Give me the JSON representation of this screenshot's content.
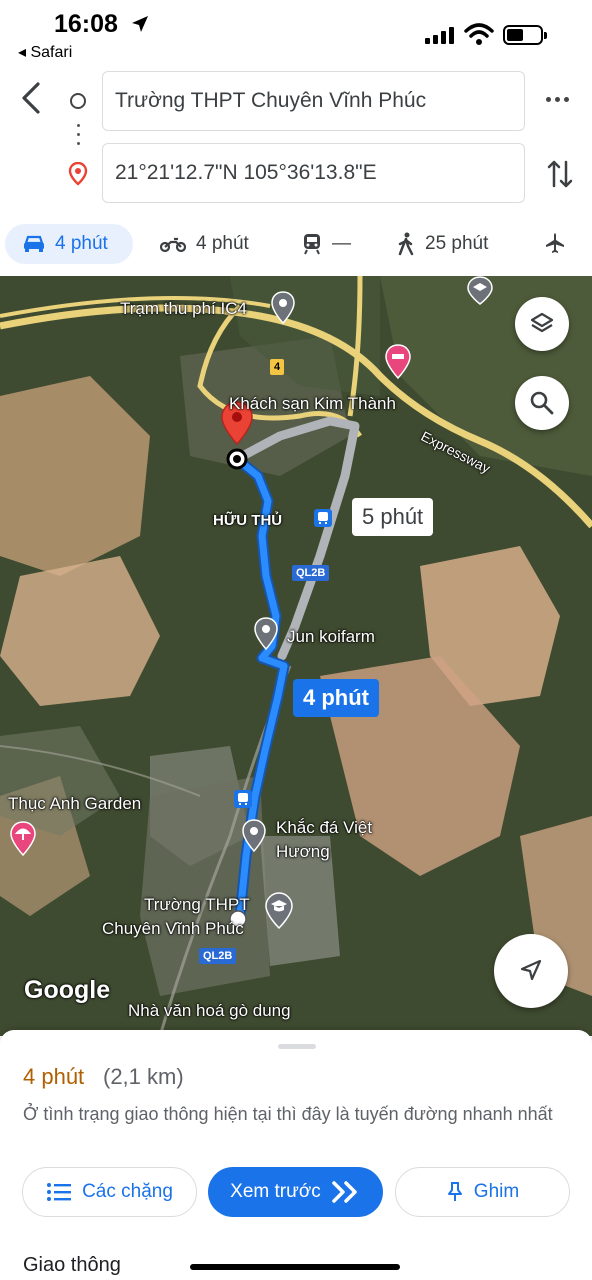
{
  "status_bar": {
    "time": "16:08",
    "back_app": "◂ Safari"
  },
  "directions": {
    "origin": "Trường THPT Chuyên Vĩnh Phúc",
    "destination": "21°21'12.7\"N 105°36'13.8\"E"
  },
  "modes": [
    {
      "icon": "car-icon",
      "label": "4 phút",
      "active": true
    },
    {
      "icon": "motorbike-icon",
      "label": "4 phút"
    },
    {
      "icon": "train-icon",
      "label": "—"
    },
    {
      "icon": "walk-icon",
      "label": "25 phút"
    },
    {
      "icon": "plane-icon",
      "label": ""
    }
  ],
  "map": {
    "labels": {
      "toll": "Trạm thu phí IC4",
      "hotel": "Khách sạn Kim Thành",
      "expressway": "Expressway",
      "huu_thu": "HỮU THỦ",
      "koi": "Jun koifarm",
      "garden": "Thục Anh Garden",
      "stone_1": "Khắc đá Việt",
      "stone_2": "Hương",
      "school_1": "Trường THPT",
      "school_2": "Chuyên Vĩnh Phúc",
      "culture": "Nhà văn hoá gò dung",
      "ql2b_a": "QL2B",
      "ql2b_b": "QL2B",
      "road4": "4"
    },
    "route_primary": "4 phút",
    "route_alt": "5 phút",
    "logo": "Google"
  },
  "sheet": {
    "duration": "4 phút",
    "distance": "(2,1 km)",
    "note": "Ở tình trạng giao thông hiện tại thì đây là tuyến đường nhanh nhất",
    "steps_label": "Các chặng",
    "preview_label": "Xem trước",
    "pin_label": "Ghim",
    "traffic": "Giao thông"
  },
  "colors": {
    "accent": "#1a73e8",
    "duration": "#b06000",
    "route": "#2b8cff",
    "alt_route": "#b0b4b8",
    "pin": "#ea4335"
  }
}
